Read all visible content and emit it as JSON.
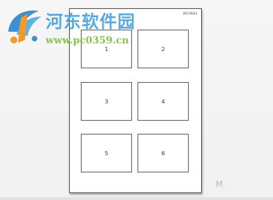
{
  "document": {
    "header_date": "2017/9/23",
    "slides": [
      {
        "number": "1"
      },
      {
        "number": "2"
      },
      {
        "number": "3"
      },
      {
        "number": "4"
      },
      {
        "number": "5"
      },
      {
        "number": "6"
      }
    ]
  },
  "watermark": {
    "title": "河东软件园",
    "url": "www.pc0359.cn",
    "title_color": "#4aa4dc",
    "url_color": "#7bbf3c"
  },
  "corner_mark": "M",
  "colors": {
    "background": "#f4f4f4",
    "page": "#ffffff",
    "page_border": "#4a4a4a"
  }
}
